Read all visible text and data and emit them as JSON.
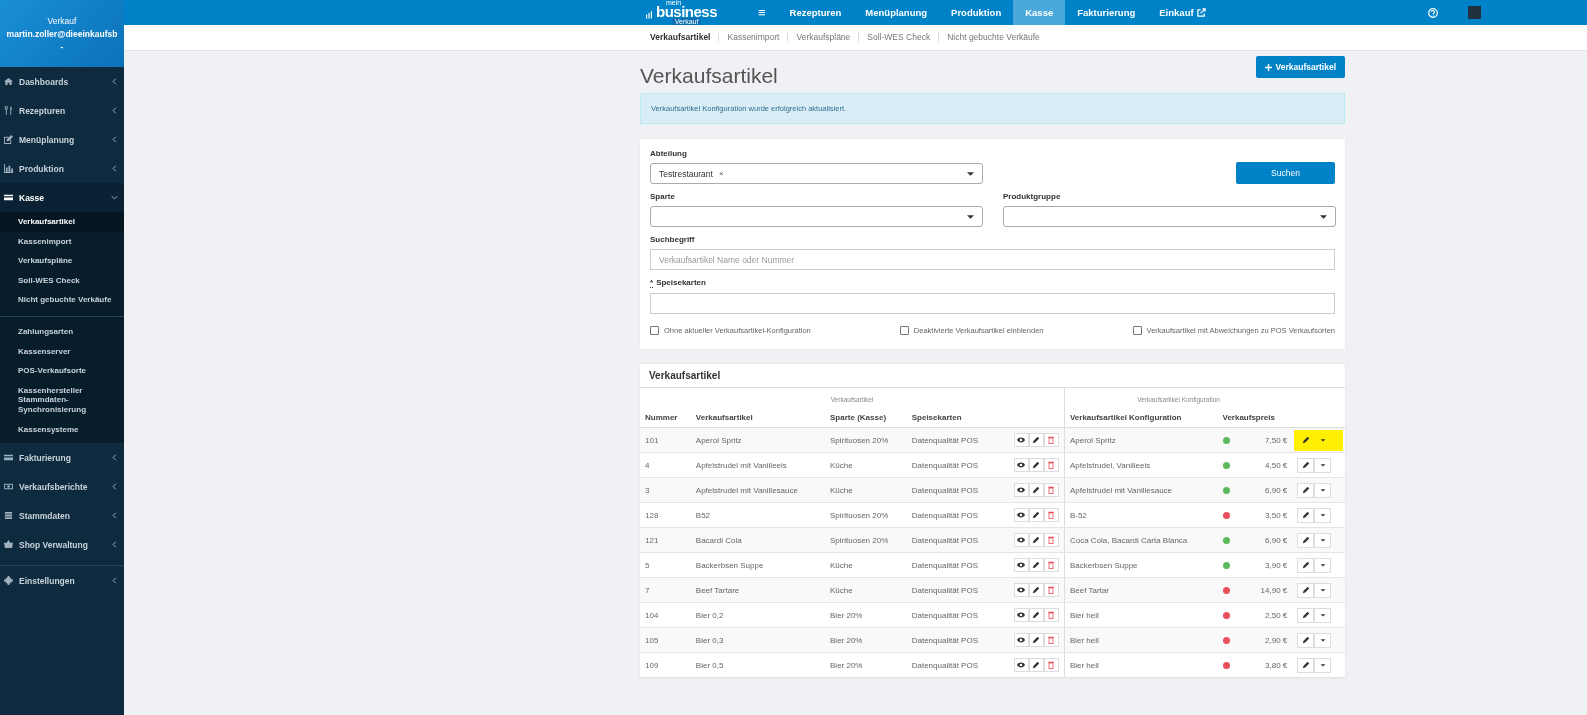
{
  "sidebar": {
    "header": {
      "title": "Verkauf",
      "user": "martin.zoller@dieeinkaufsb",
      "caret": "-"
    },
    "items": [
      {
        "label": "Dashboards",
        "expanded": false,
        "selected": false,
        "separator_before": false
      },
      {
        "label": "Rezepturen",
        "expanded": false,
        "selected": false,
        "separator_before": false
      },
      {
        "label": "Menüplanung",
        "expanded": false,
        "selected": false,
        "separator_before": false
      },
      {
        "label": "Produktion",
        "expanded": false,
        "selected": false,
        "separator_before": false
      },
      {
        "label": "Kasse",
        "expanded": true,
        "selected": true,
        "separator_before": false,
        "children": [
          {
            "label": "Verkaufsartikel",
            "selected": true,
            "separator_before": false
          },
          {
            "label": "Kassenimport",
            "selected": false,
            "separator_before": false
          },
          {
            "label": "Verkaufspläne",
            "selected": false,
            "separator_before": false
          },
          {
            "label": "Soll-WES Check",
            "selected": false,
            "separator_before": false
          },
          {
            "label": "Nicht gebuchte Verkäufe",
            "selected": false,
            "separator_before": false
          },
          {
            "label": "Zahlungsarten",
            "selected": false,
            "separator_before": true
          },
          {
            "label": "Kassenserver",
            "selected": false,
            "separator_before": false
          },
          {
            "label": "POS-Verkaufsorte",
            "selected": false,
            "separator_before": false
          },
          {
            "label": "Kassenhersteller Stammdaten-Synchronisierung",
            "selected": false,
            "separator_before": false
          },
          {
            "label": "Kassensysteme",
            "selected": false,
            "separator_before": false
          }
        ]
      },
      {
        "label": "Fakturierung",
        "expanded": false,
        "selected": false,
        "separator_before": false
      },
      {
        "label": "Verkaufsberichte",
        "expanded": false,
        "selected": false,
        "separator_before": false
      },
      {
        "label": "Stammdaten",
        "expanded": false,
        "selected": false,
        "separator_before": false
      },
      {
        "label": "Shop Verwaltung",
        "expanded": false,
        "selected": false,
        "separator_before": false
      },
      {
        "label": "Einstellungen",
        "expanded": false,
        "selected": false,
        "separator_before": true
      }
    ]
  },
  "topbar": {
    "logo": {
      "small": "mein",
      "main": "business",
      "sub": "Verkauf"
    },
    "menu_icon": "≡",
    "nav": [
      {
        "label": "Rezepturen",
        "selected": false,
        "external": false
      },
      {
        "label": "Menüplanung",
        "selected": false,
        "external": false
      },
      {
        "label": "Produktion",
        "selected": false,
        "external": false
      },
      {
        "label": "Kasse",
        "selected": true,
        "external": false
      },
      {
        "label": "Fakturierung",
        "selected": false,
        "external": false
      },
      {
        "label": "Einkauf",
        "selected": false,
        "external": true
      }
    ]
  },
  "subnav": [
    {
      "label": "Verkaufsartikel",
      "selected": true
    },
    {
      "label": "Kassenimport",
      "selected": false
    },
    {
      "label": "Verkaufspläne",
      "selected": false
    },
    {
      "label": "Soll-WES Check",
      "selected": false
    },
    {
      "label": "Nicht gebuchte Verkäufe",
      "selected": false
    }
  ],
  "page": {
    "title": "Verkaufsartikel",
    "add_button": "Verkaufsartikel",
    "alert": "Verkaufsartikel Konfiguration wurde erfolgreich aktualisiert."
  },
  "filters": {
    "abteilung": {
      "label": "Abteilung",
      "tag": "Testrestaurant",
      "remove": "×"
    },
    "search_button": "Suchen",
    "sparte": {
      "label": "Sparte"
    },
    "produktgruppe": {
      "label": "Produktgruppe"
    },
    "suchbegriff": {
      "label": "Suchbegriff",
      "placeholder": "Verkaufsartikel Name oder Nummer"
    },
    "speisekarten": {
      "required_mark": "*",
      "label": "Speisekarten"
    },
    "checkboxes": [
      {
        "label": "Ohne aktueller Verkaufsartikel-Konfiguration",
        "checked": false
      },
      {
        "label": "Deaktivierte Verkaufsartikel einblenden",
        "checked": false
      },
      {
        "label": "Verkaufsartikel mit Abweichungen zu POS Verkaufsorten",
        "checked": false
      }
    ]
  },
  "table": {
    "title": "Verkaufsartikel",
    "groups": [
      "Verkaufsartikel",
      "Verkaufsartikel Konfiguration"
    ],
    "columns": [
      "Nummer",
      "Verkaufsartikel",
      "Sparte (Kasse)",
      "Speisekarten",
      "Verkaufsartikel Konfiguration",
      "Verkaufspreis"
    ],
    "rows": [
      {
        "nummer": "101",
        "artikel": "Aperol Spritz",
        "sparte": "Spirituosen 20%",
        "speisekarten": "Datenqualität POS",
        "konfiguration": "Aperol Spritz",
        "color": "#5cb85c",
        "preis": "7,50 €",
        "highlighted": true
      },
      {
        "nummer": "4",
        "artikel": "Apfelstrudel mit Vanilleeis",
        "sparte": "Küche",
        "speisekarten": "Datenqualität POS",
        "konfiguration": "Apfelstrudel, Vanilleeis",
        "color": "#5cb85c",
        "preis": "4,50 €",
        "highlighted": false
      },
      {
        "nummer": "3",
        "artikel": "Apfelstrudel mit Vanillesauce",
        "sparte": "Küche",
        "speisekarten": "Datenqualität POS",
        "konfiguration": "Apfelstrudel mit Vanillesauce",
        "color": "#5cb85c",
        "preis": "6,90 €",
        "highlighted": false
      },
      {
        "nummer": "128",
        "artikel": "B52",
        "sparte": "Spirituosen 20%",
        "speisekarten": "Datenqualität POS",
        "konfiguration": "B-52",
        "color": "#e8505b",
        "preis": "3,50 €",
        "highlighted": false
      },
      {
        "nummer": "121",
        "artikel": "Bacardi Cola",
        "sparte": "Spirituosen 20%",
        "speisekarten": "Datenqualität POS",
        "konfiguration": "Coca Cola, Bacardi Carta Blanca",
        "color": "#5cb85c",
        "preis": "6,90 €",
        "highlighted": false
      },
      {
        "nummer": "5",
        "artikel": "Backerbsen Suppe",
        "sparte": "Küche",
        "speisekarten": "Datenqualität POS",
        "konfiguration": "Backerbsen Suppe",
        "color": "#5cb85c",
        "preis": "3,90 €",
        "highlighted": false
      },
      {
        "nummer": "7",
        "artikel": "Beef Tartare",
        "sparte": "Küche",
        "speisekarten": "Datenqualität POS",
        "konfiguration": "Beef Tartar",
        "color": "#e8505b",
        "preis": "14,90 €",
        "highlighted": false
      },
      {
        "nummer": "104",
        "artikel": "Bier 0,2",
        "sparte": "Bier 20%",
        "speisekarten": "Datenqualität POS",
        "konfiguration": "Bier hell",
        "color": "#e8505b",
        "preis": "2,50 €",
        "highlighted": false
      },
      {
        "nummer": "105",
        "artikel": "Bier 0,3",
        "sparte": "Bier 20%",
        "speisekarten": "Datenqualität POS",
        "konfiguration": "Bier hell",
        "color": "#e8505b",
        "preis": "2,90 €",
        "highlighted": false
      },
      {
        "nummer": "109",
        "artikel": "Bier 0,5",
        "sparte": "Bier 20%",
        "speisekarten": "Datenqualität POS",
        "konfiguration": "Bier hell",
        "color": "#e8505b",
        "preis": "3,80 €",
        "highlighted": false
      }
    ]
  }
}
